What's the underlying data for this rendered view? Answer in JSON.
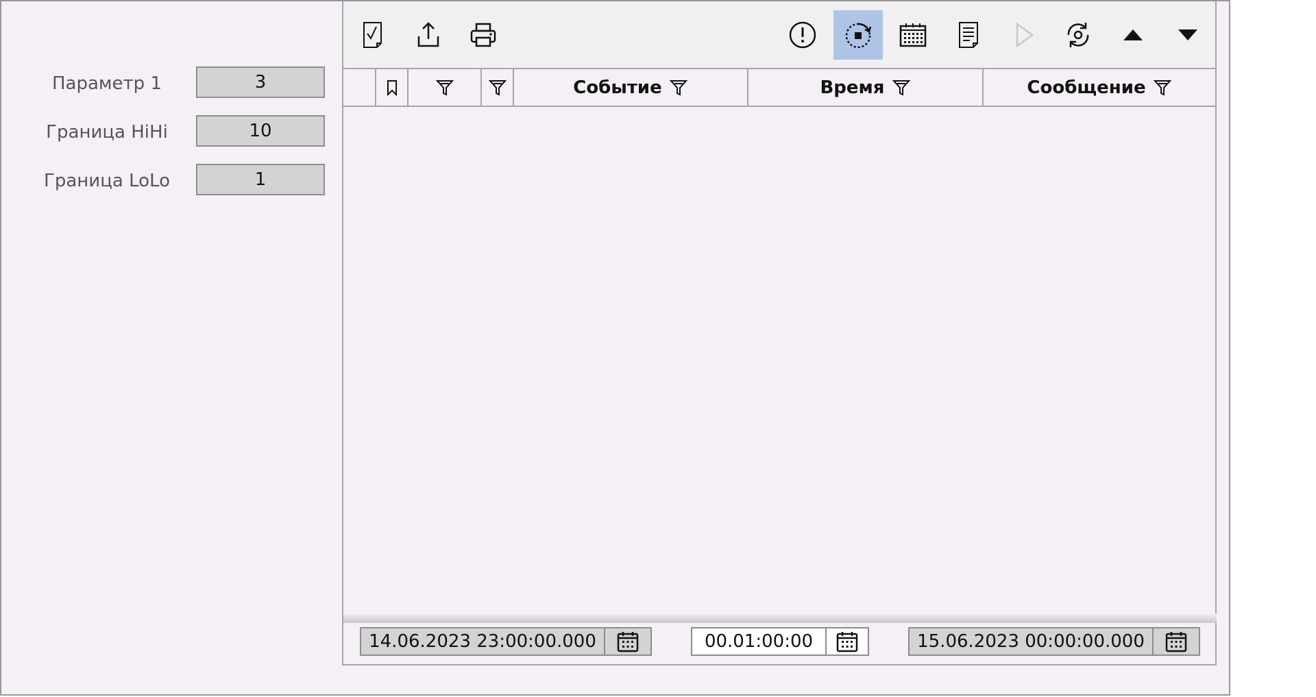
{
  "params": [
    {
      "label": "Параметр 1",
      "value": "3"
    },
    {
      "label": "Граница HiHi",
      "value": "10"
    },
    {
      "label": "Граница LoLo",
      "value": "1"
    }
  ],
  "toolbar": {
    "buttons": [
      {
        "name": "acknowledge-document-icon"
      },
      {
        "name": "export-icon"
      },
      {
        "name": "print-icon"
      },
      {
        "name": "alarm-exclamation-icon"
      },
      {
        "name": "stop-refresh-icon",
        "active": true
      },
      {
        "name": "calendar-range-icon"
      },
      {
        "name": "report-document-icon"
      },
      {
        "name": "play-icon",
        "disabled": true
      },
      {
        "name": "sync-settings-icon"
      },
      {
        "name": "arrow-up-icon"
      },
      {
        "name": "arrow-down-icon"
      }
    ]
  },
  "table": {
    "columns": [
      {
        "title": ""
      },
      {
        "title": ""
      },
      {
        "title": ""
      },
      {
        "title": ""
      },
      {
        "title": "Событие"
      },
      {
        "title": "Время"
      },
      {
        "title": "Сообщение"
      }
    ],
    "rows": []
  },
  "range": {
    "start": "14.06.2023 23:00:00.000",
    "interval": "00.01:00:00",
    "end": "15.06.2023 00:00:00.000"
  },
  "colors": {
    "active_button": "#aec4e6",
    "field_background": "#d3d3d3",
    "panel_background": "#f4f0f5"
  }
}
